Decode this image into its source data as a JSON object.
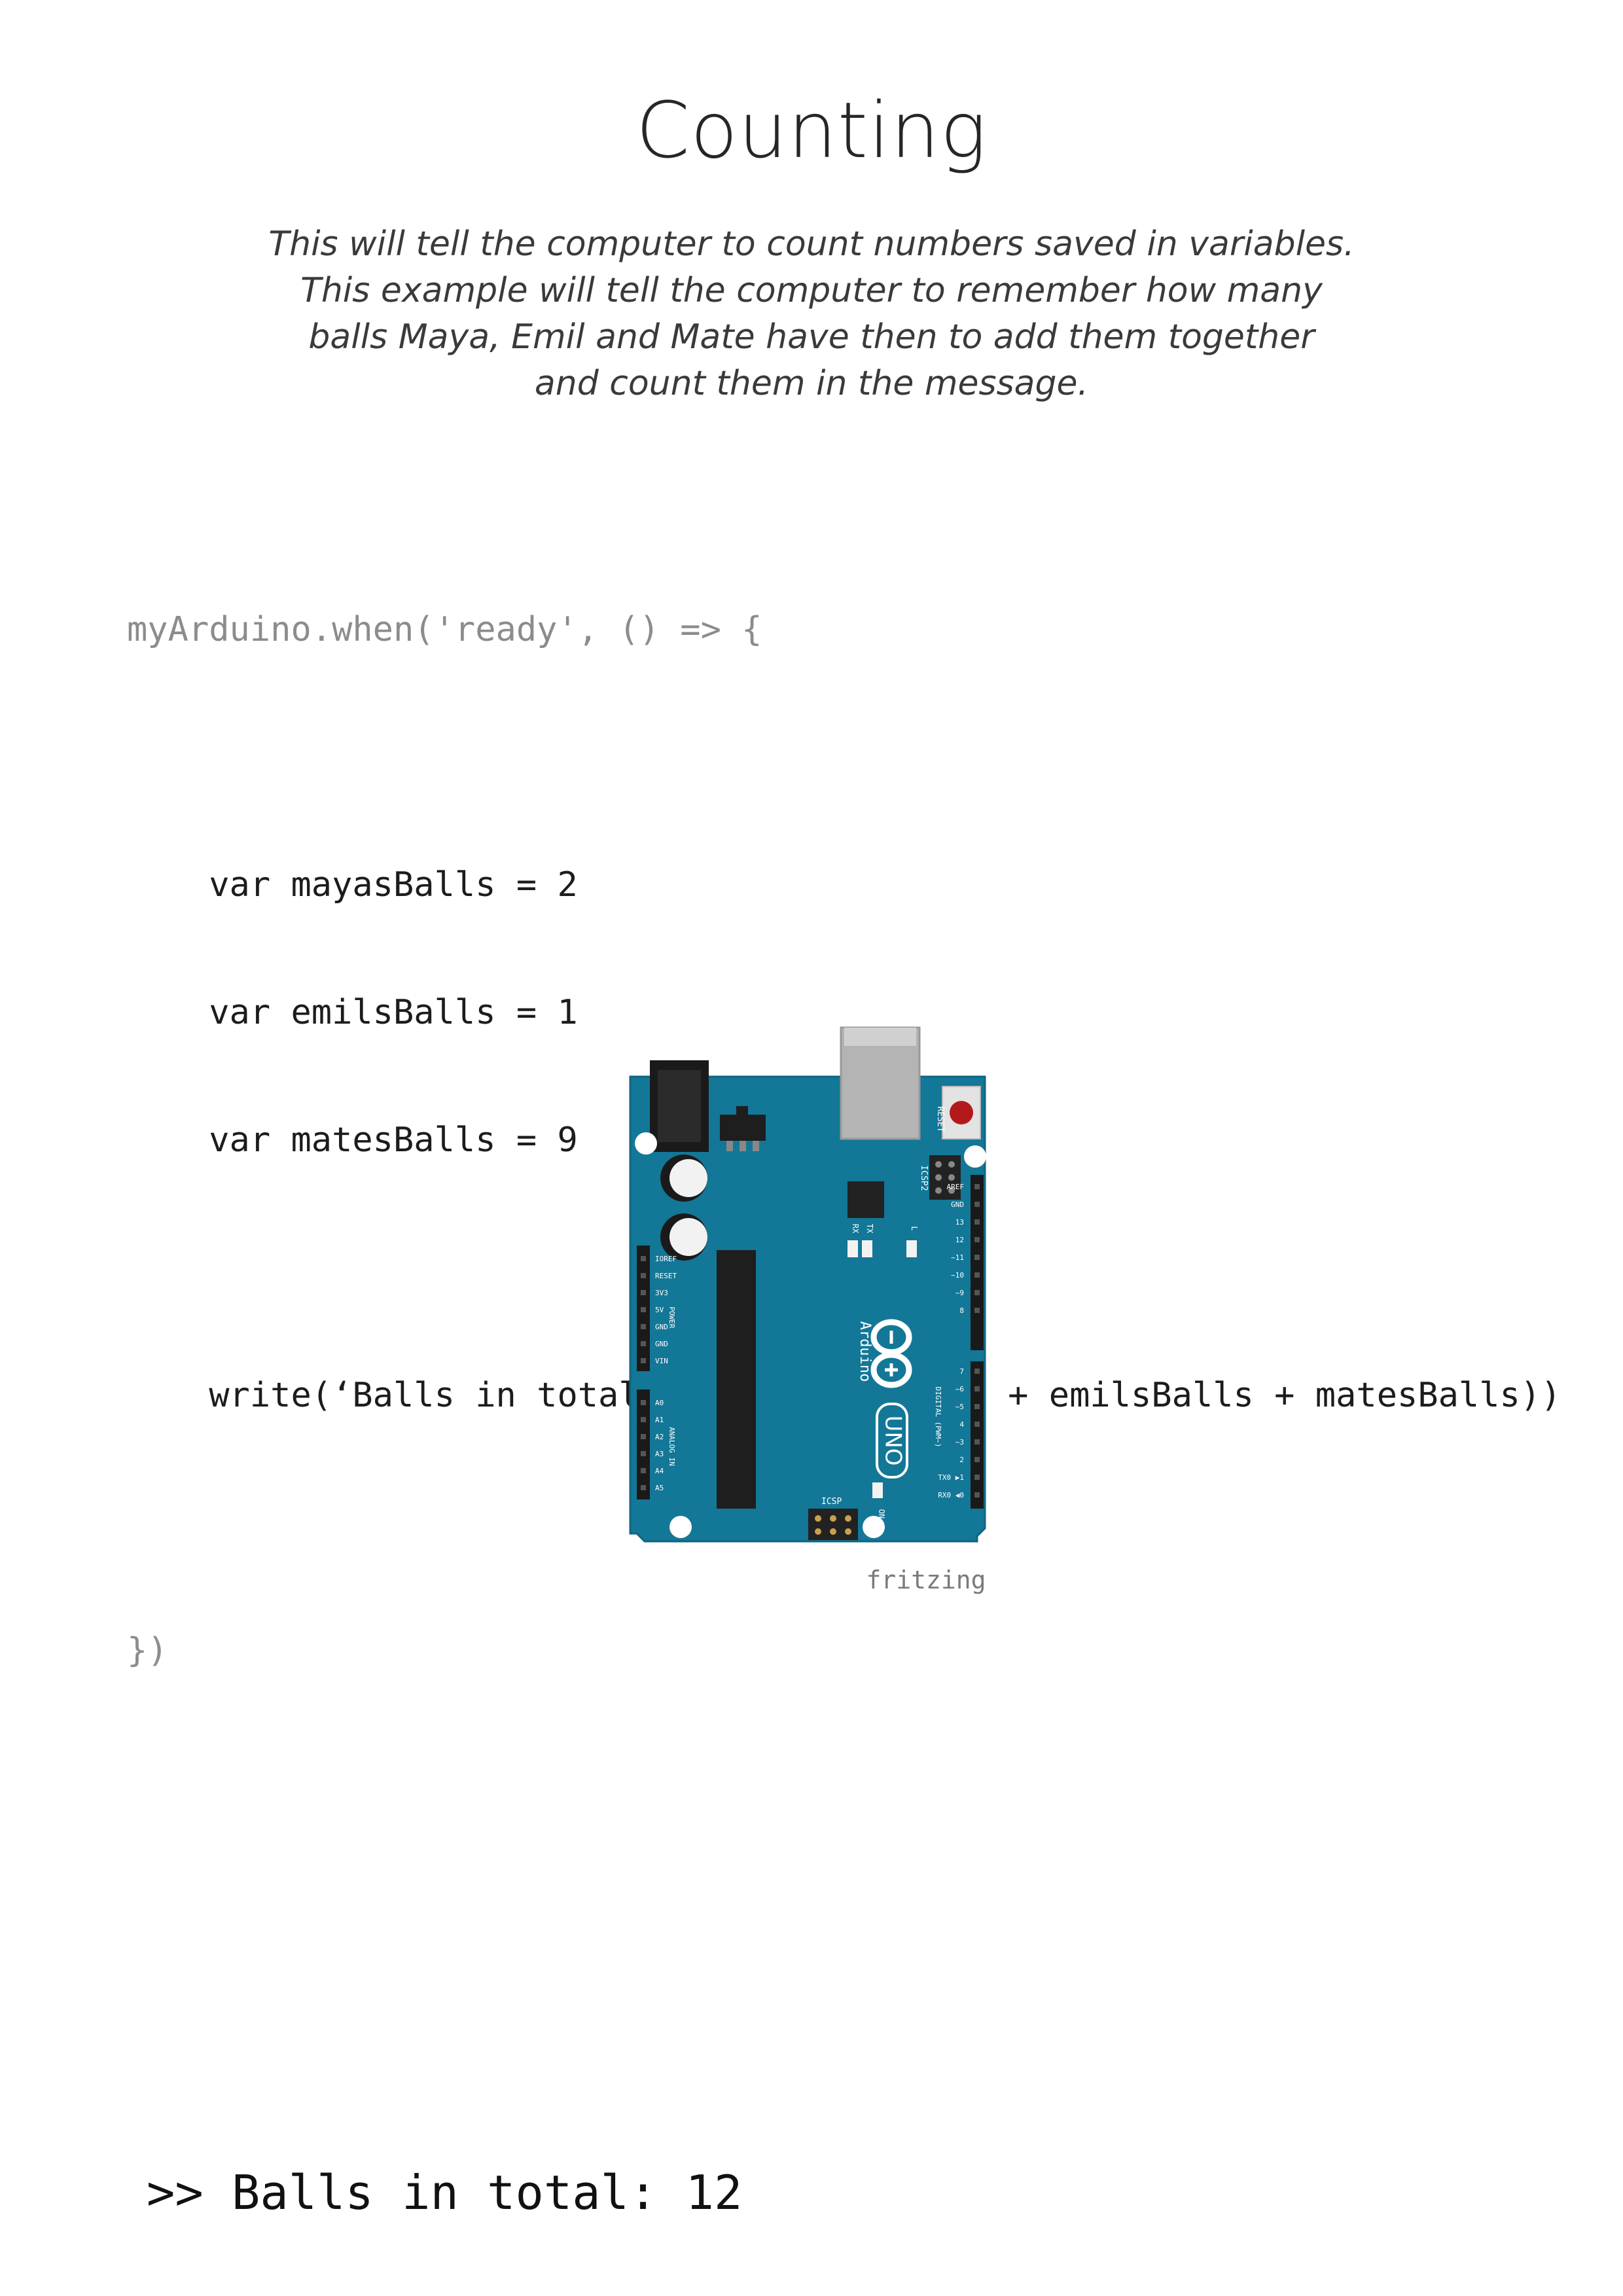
{
  "page": {
    "title": "Counting",
    "intro_lines": [
      "This will tell the computer to count numbers saved in variables.",
      "This example will tell the computer to remember how many",
      "balls Maya, Emil and Mate have then to add them together",
      "and count them in the message."
    ]
  },
  "code": {
    "lines": [
      "myArduino.when('ready', () => {",
      "",
      "    var mayasBalls = 2",
      "    var emilsBalls = 1",
      "    var matesBalls = 9",
      "",
      "    write(‘Balls in total: ' + (mayasBalls + emilsBalls + matesBalls))",
      "",
      "})"
    ]
  },
  "board": {
    "brand": "Arduino",
    "model": "UNO",
    "reset_label": "RESET",
    "icsp2_label": "ICSP2",
    "icsp_label": "ICSP",
    "tx_label": "TX",
    "rx_label": "RX",
    "l_label": "L",
    "on_label": "ON",
    "power_label": "POWER",
    "analog_label": "ANALOG IN",
    "digital_label": "DIGITAL (PWM~)",
    "power_pins": [
      "IOREF",
      "RESET",
      "3V3",
      "5V",
      "GND",
      "GND",
      "VIN"
    ],
    "analog_pins": [
      "A0",
      "A1",
      "A2",
      "A3",
      "A4",
      "A5"
    ],
    "digital_pins_top": [
      "AREF",
      "GND",
      "13",
      "12",
      "~11",
      "~10",
      "~9",
      "8"
    ],
    "digital_pins_bottom": [
      "7",
      "~6",
      "~5",
      "4",
      "~3",
      "2",
      "TX0 ▶1",
      "RX0 ◀0"
    ],
    "watermark": "fritzing",
    "colors": {
      "pcb": "#137797",
      "pcb_dark": "#0f6680",
      "reset_button": "#b3191c",
      "usb": "#b4b4b4"
    }
  },
  "output": {
    "text": ">> Balls in total: 12"
  }
}
